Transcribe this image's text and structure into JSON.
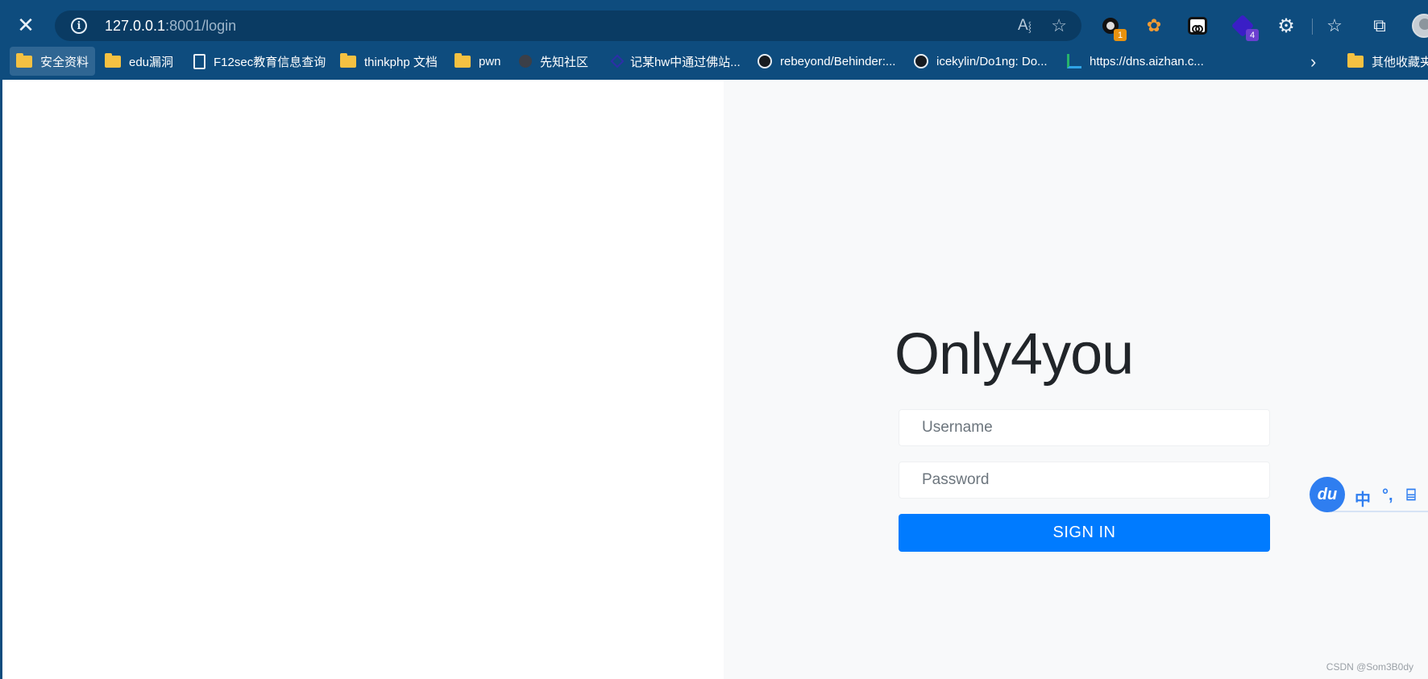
{
  "browser": {
    "close_glyph": "✕",
    "url_host": "127.0.0.1",
    "url_rest": ":8001/login",
    "icons": [
      "info-icon",
      "read-aloud-icon",
      "add-favorite-icon",
      "extensions-icon",
      "favorites-icon",
      "collections-icon"
    ],
    "extensions": [
      {
        "name": "ext-ring-icon",
        "badge": "1",
        "badge_color": "#e8920f"
      },
      {
        "name": "ext-cookie-icon",
        "badge": ""
      },
      {
        "name": "ext-mask-icon",
        "badge": ""
      },
      {
        "name": "ext-gem-icon",
        "badge": "4",
        "badge_color": "#6b3fd0"
      }
    ]
  },
  "bookmarks": [
    {
      "label": "安全资料",
      "icon": "folder-icon"
    },
    {
      "label": "edu漏洞",
      "icon": "folder-icon"
    },
    {
      "label": "F12sec教育信息查询",
      "icon": "document-icon"
    },
    {
      "label": "thinkphp 文档",
      "icon": "folder-icon"
    },
    {
      "label": "pwn",
      "icon": "folder-icon"
    },
    {
      "label": "先知社区",
      "icon": "site-icon"
    },
    {
      "label": "记某hw中通过佛站...",
      "icon": "site-icon"
    },
    {
      "label": "rebeyond/Behinder:...",
      "icon": "github-icon"
    },
    {
      "label": "icekylin/Do1ng: Do...",
      "icon": "github-icon"
    },
    {
      "label": "https://dns.aizhan.c...",
      "icon": "site-icon"
    },
    {
      "label": "其他收藏夹",
      "icon": "folder-icon"
    }
  ],
  "login": {
    "brand": "Only4you",
    "username_placeholder": "Username",
    "password_placeholder": "Password",
    "submit_label": "SIGN IN"
  },
  "ime": {
    "logo": "du",
    "mode": "中",
    "punct": "°,",
    "tool": "⌸"
  },
  "watermark": "CSDN @Som3B0dy",
  "colors": {
    "chrome_bg": "#0e4c7e",
    "urlbar_bg": "#0a3b63",
    "page_right_bg": "#f8f9fa",
    "primary_button": "#007bff",
    "ime_blue": "#2f7ef0"
  }
}
